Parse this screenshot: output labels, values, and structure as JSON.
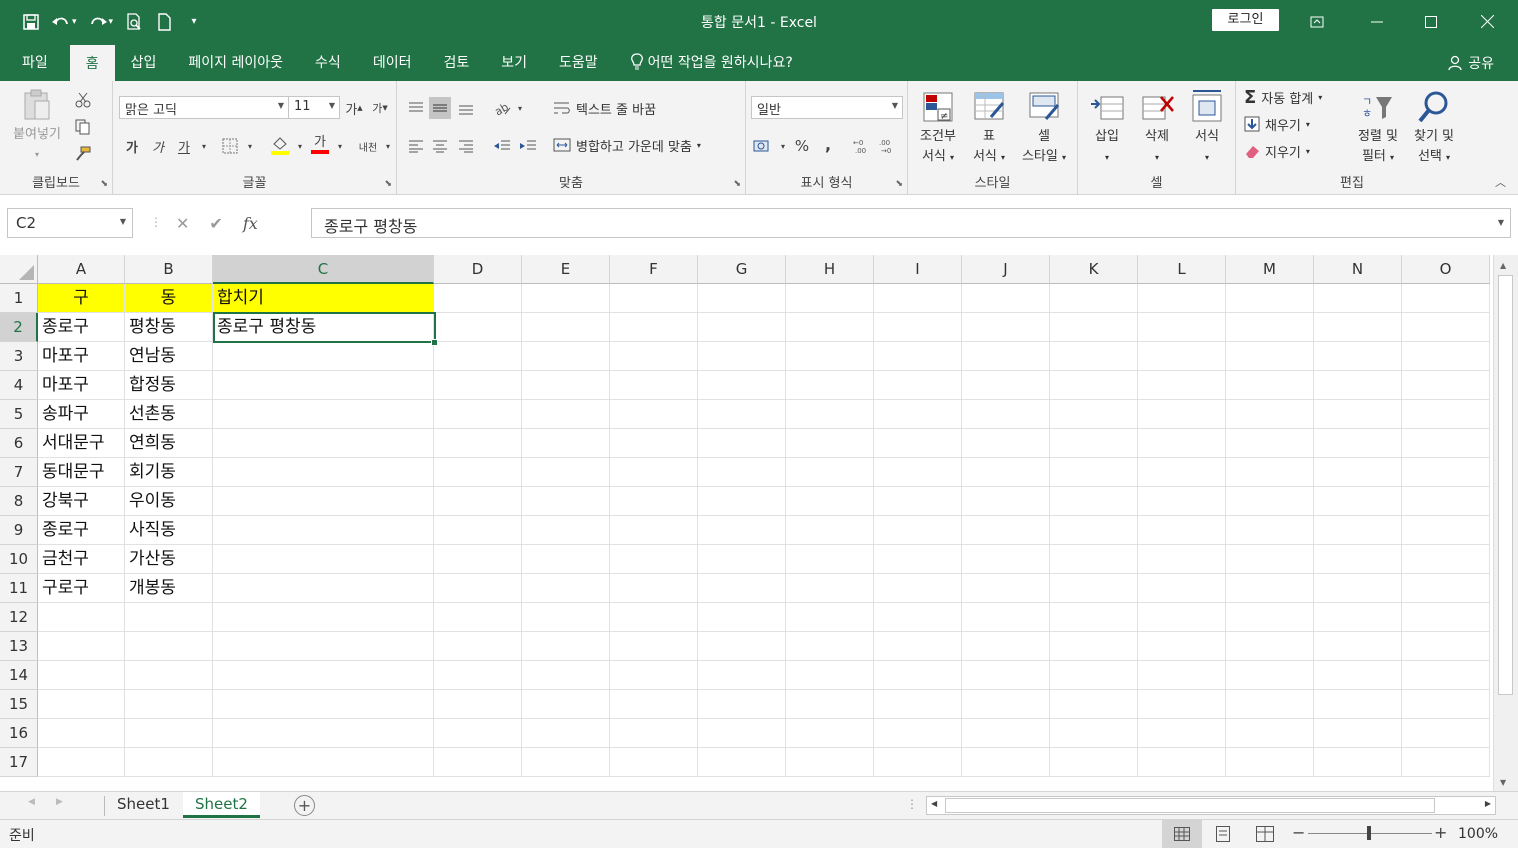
{
  "app": {
    "title": "통합 문서1  -  Excel",
    "login": "로그인",
    "share": "공유"
  },
  "qat": {
    "icons": [
      "save-icon",
      "undo-icon",
      "redo-icon",
      "print-preview-icon",
      "new-file-icon",
      "customize-icon"
    ]
  },
  "tabs": [
    "파일",
    "홈",
    "삽입",
    "페이지 레이아웃",
    "수식",
    "데이터",
    "검토",
    "보기",
    "도움말"
  ],
  "tell_me": "어떤 작업을 원하시나요?",
  "ribbon": {
    "clipboard": {
      "label": "클립보드",
      "paste": "붙여넣기"
    },
    "font": {
      "label": "글꼴",
      "font_name": "맑은 고딕",
      "font_size": "11",
      "bold": "가",
      "italic": "가",
      "underline": "가",
      "grow": "가",
      "shrink": "가",
      "font_color_label": "가",
      "phonetic": "내천"
    },
    "alignment": {
      "label": "맞춤",
      "wrap": "텍스트 줄 바꿈",
      "merge": "병합하고 가운데 맞춤"
    },
    "number": {
      "label": "표시 형식",
      "format": "일반",
      "percent": "%",
      "comma": ","
    },
    "styles": {
      "label": "스타일",
      "cond_format_1": "조건부",
      "cond_format_2": "서식",
      "table_1": "표",
      "table_2": "서식",
      "cell_style_1": "셀",
      "cell_style_2": "스타일"
    },
    "cells": {
      "label": "셀",
      "insert": "삽입",
      "delete": "삭제",
      "format": "서식"
    },
    "editing": {
      "label": "편집",
      "autosum": "자동 합계",
      "fill": "채우기",
      "clear": "지우기",
      "sort_1": "정렬 및",
      "sort_2": "필터",
      "find_1": "찾기 및",
      "find_2": "선택"
    }
  },
  "formula_bar": {
    "name_box": "C2",
    "fx": "fx",
    "content": "종로구 평창동"
  },
  "columns": [
    "A",
    "B",
    "C",
    "D",
    "E",
    "F",
    "G",
    "H",
    "I",
    "J",
    "K",
    "L",
    "M",
    "N",
    "O"
  ],
  "rows": [
    "1",
    "2",
    "3",
    "4",
    "5",
    "6",
    "7",
    "8",
    "9",
    "10",
    "11",
    "12",
    "13",
    "14",
    "15",
    "16",
    "17"
  ],
  "cells": {
    "A1": "구",
    "B1": "동",
    "C1": "합치기",
    "A2": "종로구",
    "B2": "평창동",
    "C2": "종로구 평창동",
    "A3": "마포구",
    "B3": "연남동",
    "A4": "마포구",
    "B4": "합정동",
    "A5": "송파구",
    "B5": "선촌동",
    "A6": "서대문구",
    "B6": "연희동",
    "A7": "동대문구",
    "B7": "회기동",
    "A8": "강북구",
    "B8": "우이동",
    "A9": "종로구",
    "B9": "사직동",
    "A10": "금천구",
    "B10": "가산동",
    "A11": "구로구",
    "B11": "개봉동"
  },
  "sheets": [
    "Sheet1",
    "Sheet2"
  ],
  "active_sheet": "Sheet2",
  "status": {
    "ready": "준비",
    "zoom": "100%"
  },
  "colors": {
    "accent": "#217346",
    "header_fill": "#ffff00"
  }
}
